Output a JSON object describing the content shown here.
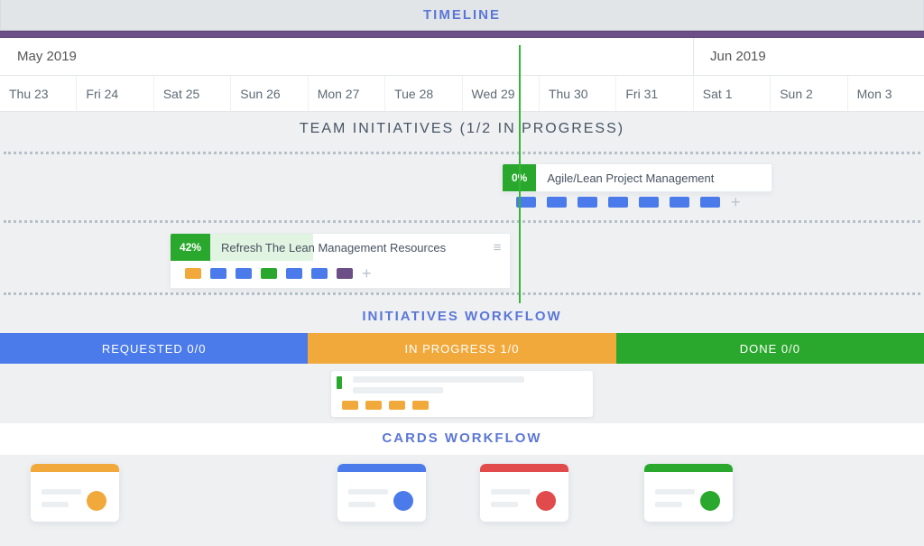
{
  "header": {
    "title": "TIMELINE"
  },
  "timeline": {
    "months": [
      {
        "label": "May 2019"
      },
      {
        "label": "Jun 2019"
      }
    ],
    "days": [
      {
        "label": "Thu 23"
      },
      {
        "label": "Fri 24"
      },
      {
        "label": "Sat 25"
      },
      {
        "label": "Sun 26"
      },
      {
        "label": "Mon 27"
      },
      {
        "label": "Tue 28"
      },
      {
        "label": "Wed 29"
      },
      {
        "label": "Thu 30"
      },
      {
        "label": "Fri 31"
      },
      {
        "label": "Sat 1"
      },
      {
        "label": "Sun 2"
      },
      {
        "label": "Mon 3"
      }
    ]
  },
  "sections": {
    "team_initiatives": "TEAM INITIATIVES (1/2 IN PROGRESS)",
    "initiatives_workflow": "INITIATIVES WORKFLOW",
    "cards_workflow": "CARDS WORKFLOW"
  },
  "initiatives": [
    {
      "pct": "0%",
      "title": "Agile/Lean Project Management",
      "progress_width": "0%",
      "chips": [
        "blue",
        "blue",
        "blue",
        "blue",
        "blue",
        "blue",
        "blue",
        "blue"
      ]
    },
    {
      "pct": "42%",
      "title": "Refresh The Lean  Management Resources",
      "progress_width": "42%",
      "chips": [
        "orange",
        "blue",
        "blue",
        "green",
        "blue",
        "blue",
        "purple"
      ]
    }
  ],
  "workflow": {
    "columns": [
      {
        "label": "REQUESTED 0/0",
        "color": "blue"
      },
      {
        "label": "IN PROGRESS 1/0",
        "color": "orange"
      },
      {
        "label": "DONE 0/0",
        "color": "green"
      }
    ]
  },
  "cards": {
    "tiles": [
      {
        "color": "orange",
        "column": 0
      },
      {
        "color": "blue",
        "column": 1
      },
      {
        "color": "red",
        "column": 1
      },
      {
        "color": "green",
        "column": 2
      }
    ]
  },
  "colors": {
    "purple": "#6b4f86",
    "blue": "#4b7bea",
    "orange": "#f2a93b",
    "green": "#2aa82d",
    "red": "#e24b4b"
  }
}
